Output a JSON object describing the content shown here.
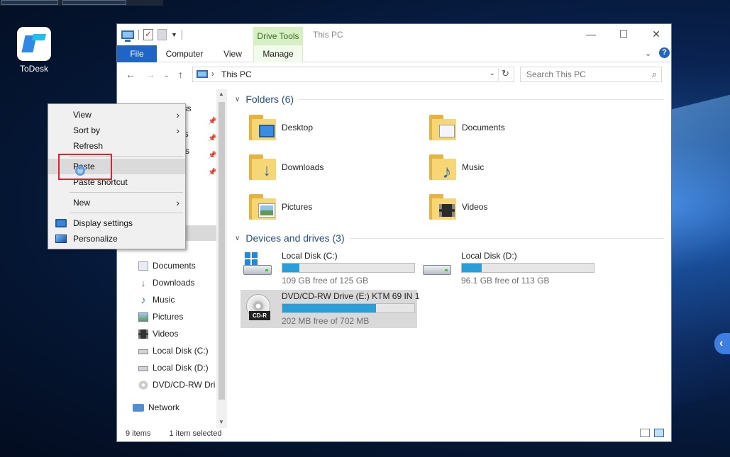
{
  "desktop": {
    "icons": [
      {
        "label": "ToDesk",
        "icon": "todesk-logo-icon"
      }
    ],
    "edge_button": "‹"
  },
  "window": {
    "title": "This PC",
    "contextual_tab_group": "Drive Tools",
    "controls": {
      "minimize": "—",
      "maximize": "☐",
      "close": "✕"
    },
    "ribbon_tabs": [
      "File",
      "Computer",
      "View",
      "Manage"
    ],
    "address": {
      "location": "This PC",
      "separator": "›"
    },
    "search": {
      "placeholder": "Search This PC"
    },
    "nav": {
      "items": [
        {
          "label": "Documents",
          "icon": "documents-icon"
        },
        {
          "label": "Downloads",
          "icon": "downloads-icon"
        },
        {
          "label": "Music",
          "icon": "music-icon"
        },
        {
          "label": "Pictures",
          "icon": "pictures-icon"
        },
        {
          "label": "Videos",
          "icon": "videos-icon"
        },
        {
          "label": "Local Disk (C:)",
          "icon": "hard-disk-icon"
        },
        {
          "label": "Local Disk (D:)",
          "icon": "hard-disk-icon"
        },
        {
          "label": "DVD/CD-RW Dri",
          "icon": "dvd-drive-icon"
        },
        {
          "label": "Network",
          "icon": "network-icon"
        }
      ],
      "partial_labels": [
        "ess",
        "ds",
        "nts"
      ]
    },
    "folders": {
      "header": "Folders (6)",
      "items": [
        "Desktop",
        "Documents",
        "Downloads",
        "Music",
        "Pictures",
        "Videos"
      ]
    },
    "drives": {
      "header": "Devices and drives (3)",
      "items": [
        {
          "name": "Local Disk (C:)",
          "free": "109 GB free of 125 GB",
          "used_fraction": 0.13
        },
        {
          "name": "Local Disk (D:)",
          "free": "96.1 GB free of 113 GB",
          "used_fraction": 0.15
        },
        {
          "name": "DVD/CD-RW Drive (E:) KTM 69 IN 1",
          "free": "202 MB free of 702 MB",
          "used_fraction": 0.71,
          "badge": "CD-R"
        }
      ]
    },
    "status": {
      "count": "9 items",
      "selection": "1 item selected"
    }
  },
  "context_menu": {
    "items": [
      {
        "label": "View",
        "submenu": true
      },
      {
        "label": "Sort by",
        "submenu": true
      },
      {
        "label": "Refresh",
        "submenu": false
      },
      {
        "label": "Paste",
        "submenu": false,
        "highlighted": true
      },
      {
        "label": "Paste shortcut",
        "submenu": false
      },
      {
        "label": "New",
        "submenu": true
      },
      {
        "label": "Display settings",
        "submenu": false,
        "icon": "display-settings-icon"
      },
      {
        "label": "Personalize",
        "submenu": false,
        "icon": "personalize-icon"
      }
    ],
    "submenu_arrow": "›"
  },
  "colors": {
    "accent": "#1e65c6",
    "drive_bar": "#26a0da",
    "highlight_box": "#e3202b",
    "drive_tools": "#d6efc3"
  }
}
